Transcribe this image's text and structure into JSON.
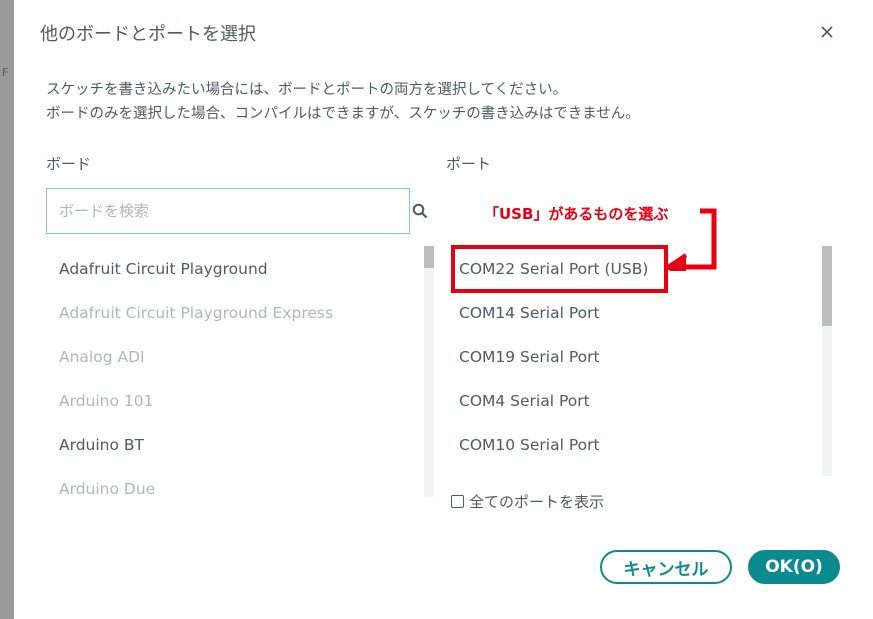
{
  "dialog": {
    "title": "他のボードとポートを選択",
    "description_line1": "スケッチを書き込みたい場合には、ボードとポートの両方を選択してください。",
    "description_line2": "ボードのみを選択した場合、コンパイルはできますが、スケッチの書き込みはできません。"
  },
  "background_fragment": "F",
  "boards": {
    "label": "ボード",
    "search_placeholder": "ボードを検索",
    "items": [
      {
        "label": "Adafruit Circuit Playground",
        "enabled": true
      },
      {
        "label": "Adafruit Circuit Playground Express",
        "enabled": false
      },
      {
        "label": "Analog ADI",
        "enabled": false
      },
      {
        "label": "Arduino 101",
        "enabled": false
      },
      {
        "label": "Arduino BT",
        "enabled": true
      },
      {
        "label": "Arduino Due",
        "enabled": false
      }
    ]
  },
  "ports": {
    "label": "ポート",
    "items": [
      {
        "label": "COM22 Serial Port (USB)"
      },
      {
        "label": "COM14 Serial Port"
      },
      {
        "label": "COM19 Serial Port"
      },
      {
        "label": "COM4 Serial Port"
      },
      {
        "label": "COM10 Serial Port"
      }
    ],
    "show_all_label": "全てのポートを表示",
    "show_all_checked": false
  },
  "buttons": {
    "cancel": "キャンセル",
    "ok": "OK(O)"
  },
  "annotation": {
    "text": "「USB」があるものを選ぶ",
    "color": "#e60012"
  },
  "colors": {
    "accent": "#0b8a8f",
    "text": "#4e5b61",
    "disabled_text": "#b0b7ba"
  },
  "icons": [
    "close-icon",
    "search-icon",
    "arrow-icon"
  ]
}
